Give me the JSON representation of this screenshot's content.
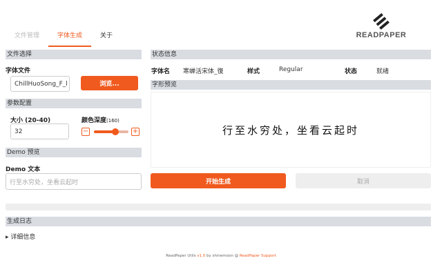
{
  "tabs": [
    {
      "label": "文件管理"
    },
    {
      "label": "字体生成"
    },
    {
      "label": "关于"
    }
  ],
  "logo": {
    "text": "READPAPER"
  },
  "file_select": {
    "header": "文件选择",
    "font_file_label": "字体文件",
    "font_file_value": "ChillHuoSong_F_l",
    "browse_label": "浏览..."
  },
  "params": {
    "header": "参数配置",
    "size_label": "大小 (20-40)",
    "size_value": "32",
    "depth_label": "颜色深度",
    "depth_value": "(160)",
    "depth_level": 160,
    "depth_max": 255,
    "minus": "−",
    "plus": "+"
  },
  "demo": {
    "header": "Demo 预览",
    "text_label": "Demo 文本",
    "placeholder": "行至水穷处，坐看云起时"
  },
  "status": {
    "header": "状态信息",
    "font_name_label": "字体名",
    "font_name_value": "寒蝉活宋体_復",
    "style_label": "样式",
    "style_value": "Regular",
    "state_label": "状态",
    "state_value": "就绪"
  },
  "glyph_preview": {
    "header": "字形预览",
    "text": "行至水穷处，坐看云起时"
  },
  "actions": {
    "start_label": "开始生成",
    "cancel_label": "取消"
  },
  "log": {
    "header": "生成日志",
    "details_label": "▸ 详细信息"
  },
  "footer": {
    "prefix": "ReadPaper Utils",
    "version": "v1.0",
    "by": "by shinemoon @",
    "support": "ReadPaper Support"
  },
  "colors": {
    "accent": "#f05a1e",
    "section": "#d9dde2"
  }
}
